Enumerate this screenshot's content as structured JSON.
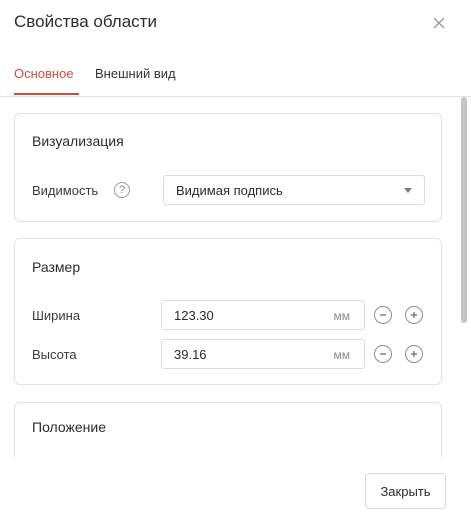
{
  "dialog": {
    "title": "Свойства области",
    "close_icon": "close-icon"
  },
  "tabs": [
    {
      "label": "Основное",
      "active": true
    },
    {
      "label": "Внешний вид",
      "active": false
    }
  ],
  "colors": {
    "accent": "#d44a3e",
    "border": "#e1e1e1",
    "text": "#2b2b2b",
    "muted": "#8a8a8a"
  },
  "visualization": {
    "title": "Визуализация",
    "visibility_label": "Видимость",
    "help_icon": "question-icon",
    "help_glyph": "?",
    "visibility_value": "Видимая подпись"
  },
  "size": {
    "title": "Размер",
    "width": {
      "label": "Ширина",
      "value": "123.30",
      "unit": "мм"
    },
    "height": {
      "label": "Высота",
      "value": "39.16",
      "unit": "мм"
    }
  },
  "position": {
    "title": "Положение"
  },
  "footer": {
    "close_label": "Закрыть"
  }
}
